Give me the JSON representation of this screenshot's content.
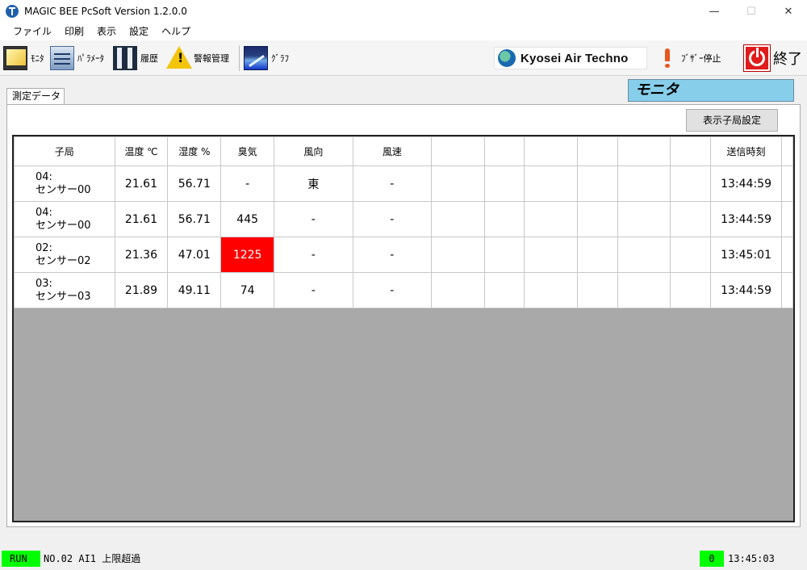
{
  "window": {
    "title": "MAGIC BEE PcSoft Version 1.2.0.0"
  },
  "menu": [
    "ファイル",
    "印刷",
    "表示",
    "設定",
    "ヘルプ"
  ],
  "toolbar": {
    "monitor": "ﾓﾆﾀ",
    "parameter": "ﾊﾟﾗﾒｰﾀ",
    "history": "履歴",
    "alarm": "警報管理",
    "graph": "ｸﾞﾗﾌ",
    "brand": "Kyosei Air Techno",
    "buzzer_stop": "ﾌﾞｻﾞｰ停止",
    "exit": "終了"
  },
  "tab": {
    "label": "測定データ"
  },
  "mode": {
    "label": "モニタ"
  },
  "settings_button": "表示子局設定",
  "table": {
    "headers": [
      "子局",
      "温度 ℃",
      "湿度 %",
      "臭気",
      "風向",
      "風速",
      "",
      "",
      "",
      "",
      "",
      "",
      "送信時刻"
    ],
    "rows": [
      {
        "station_id": "04:",
        "station_name": "センサー00",
        "temp": "21.61",
        "humidity": "56.71",
        "odor": "-",
        "wind_dir": "東",
        "wind_speed": "-",
        "time": "13:44:59",
        "alarm": false
      },
      {
        "station_id": "04:",
        "station_name": "センサー00",
        "temp": "21.61",
        "humidity": "56.71",
        "odor": "445",
        "wind_dir": "-",
        "wind_speed": "-",
        "time": "13:44:59",
        "alarm": false
      },
      {
        "station_id": "02:",
        "station_name": "センサー02",
        "temp": "21.36",
        "humidity": "47.01",
        "odor": "1225",
        "wind_dir": "-",
        "wind_speed": "-",
        "time": "13:45:01",
        "alarm": true
      },
      {
        "station_id": "03:",
        "station_name": "センサー03",
        "temp": "21.89",
        "humidity": "49.11",
        "odor": "74",
        "wind_dir": "-",
        "wind_speed": "-",
        "time": "13:44:59",
        "alarm": false
      }
    ]
  },
  "status": {
    "run": "RUN",
    "message": "NO.02 AI1 上限超過",
    "count": "0",
    "time": "13:45:03"
  },
  "colors": {
    "alarm": "#ff0000",
    "status_ok": "#00ff00",
    "mode_bg": "#87ceeb"
  }
}
